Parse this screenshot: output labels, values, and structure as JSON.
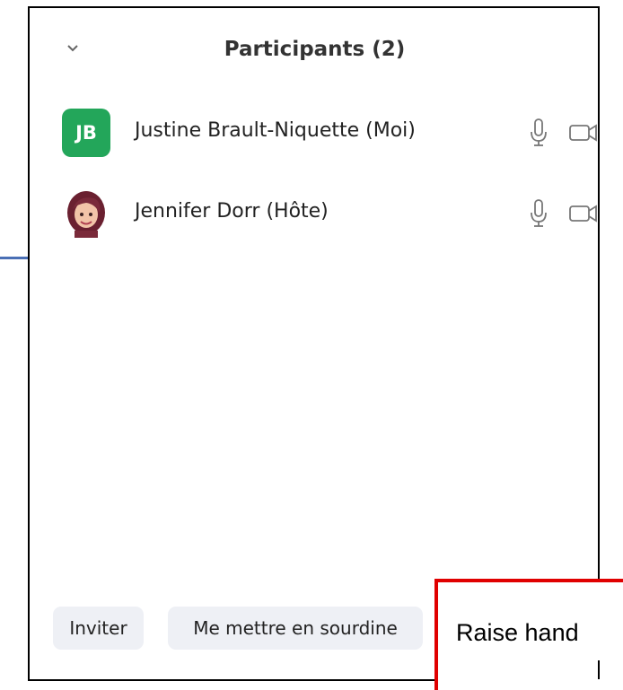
{
  "panel": {
    "title": "Participants (2)"
  },
  "participants": [
    {
      "initials": "JB",
      "name": "Justine Brault-Niquette (Moi)",
      "avatar_color": "#23a65a"
    },
    {
      "initials": "",
      "name": "Jennifer Dorr (Hôte)",
      "avatar_color": "#7a2a3a"
    }
  ],
  "footer": {
    "invite_label": "Inviter",
    "mute_label": "Me mettre en sourdine",
    "raise_hand_label": "Raise hand"
  },
  "colors": {
    "highlight": "#e00000",
    "button_bg": "#eef0f5"
  },
  "icons": [
    "chevron-down-icon",
    "microphone-icon",
    "video-camera-icon"
  ]
}
